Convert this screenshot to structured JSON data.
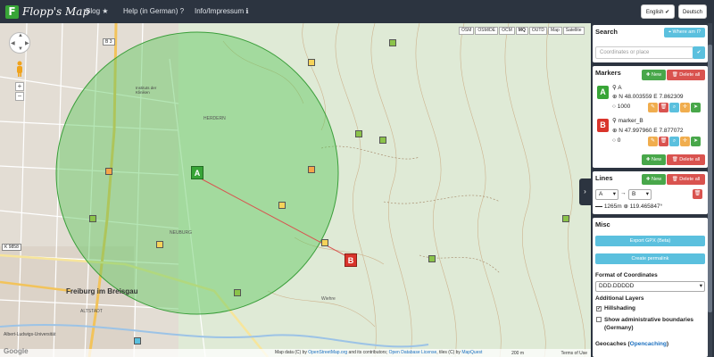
{
  "navbar": {
    "brand_logo": "F",
    "brand_name": "Flopp's Map",
    "blog": "Blog ★",
    "help": "Help (in German) ?",
    "info": "Info/Impressum ℹ",
    "lang_button": "English ✔",
    "lang_alt": "Deutsch"
  },
  "map": {
    "layers": [
      "OSM",
      "OSM/DE",
      "OCM",
      "MQ",
      "OUTD",
      "Map",
      "Satellite"
    ],
    "active_layer": "MQ",
    "labels": {
      "city": "Freiburg im Breisgau",
      "road_b3": "B 3",
      "road_k9858": "K 9858",
      "herdern": "HERDERN",
      "altstadt": "ALTSTADT",
      "neuburg": "NEUBURG",
      "wiehre": "Wiehre",
      "uni": "Albert-Ludwigs-Universität",
      "kliniken": "Instituts der Kliniken"
    },
    "marker_a_label": "A",
    "marker_b_label": "B",
    "attribution_prefix": "Map data (C) by ",
    "attribution_osm": "OpenStreetMap.org",
    "attribution_mid": " and its contributors; ",
    "attribution_odbl": "Open Database License",
    "attribution_tiles": ", tiles (C) by ",
    "attribution_mq": "MapQuest",
    "scale": "200 m",
    "terms": "Terms of Use",
    "google": "Google",
    "colors": {
      "circle_fill": "#5bc85b",
      "circle_stroke": "#3a9e3a",
      "line": "#d9534f",
      "marker_a": "#38a537",
      "marker_b": "#d9342b"
    }
  },
  "panel": {
    "search": {
      "title": "Search",
      "where_button": "⌖ Where am I?",
      "placeholder": "Coordinates or place",
      "go_icon": "check-icon"
    },
    "markers": {
      "title": "Markers",
      "new_button": "✚ New",
      "delete_all_button": "🗑 Delete all",
      "items": [
        {
          "letter": "A",
          "name": "A",
          "coords": "N 48.003559 E 7.862309",
          "radius": "1000",
          "color": "#38a537"
        },
        {
          "letter": "B",
          "name": "marker_B",
          "coords": "N 47.997960 E 7.877072",
          "radius": "0",
          "color": "#d9342b"
        }
      ]
    },
    "lines": {
      "title": "Lines",
      "new_button": "✚ New",
      "delete_all_button": "🗑 Delete all",
      "from": "A",
      "to": "B",
      "arrow": "→",
      "info": "1265m ⊕ 119.465847°"
    },
    "misc": {
      "title": "Misc",
      "export_button": "Export GPX (Beta)",
      "permalink_button": "Create permalink",
      "format_label": "Format of Coordinates",
      "format_value": "DDD.DDDDD",
      "layers_label": "Additional Layers",
      "hillshading": "Hillshading",
      "hillshading_checked": true,
      "boundaries": "Show administrative boundaries (Germany)",
      "boundaries_checked": false,
      "geocaches_prefix": "Geocaches (",
      "geocaches_link": "Opencaching",
      "geocaches_suffix": ")"
    }
  }
}
